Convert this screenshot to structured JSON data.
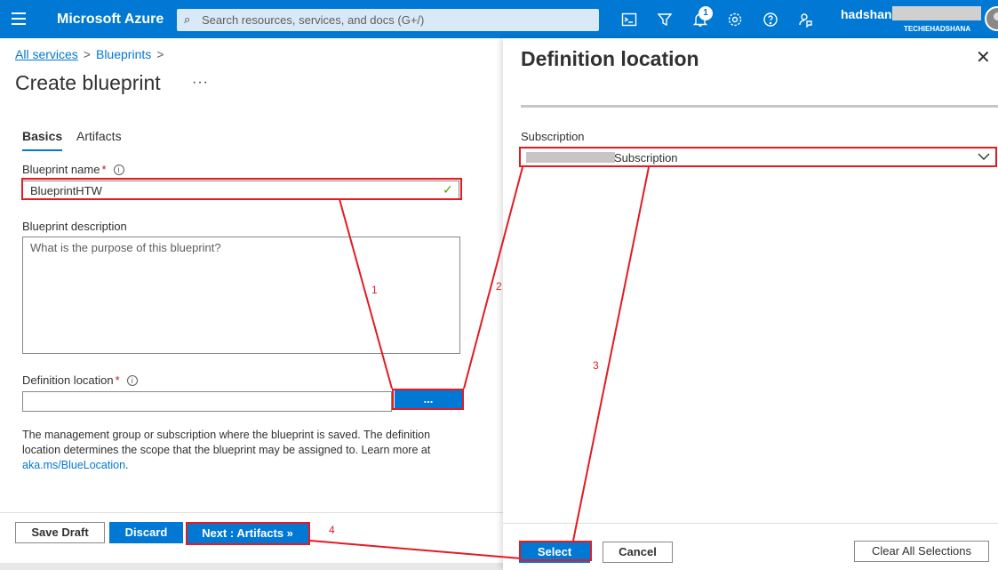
{
  "header": {
    "brand": "Microsoft Azure",
    "search_placeholder": "Search resources, services, and docs (G+/)",
    "notification_count": "1",
    "user_name": "hadshana",
    "user_directory": "TECHIEHADSHANA"
  },
  "breadcrumb": {
    "items": [
      "All services",
      "Blueprints"
    ]
  },
  "page": {
    "title": "Create blueprint",
    "more_label": "···"
  },
  "tabs": [
    "Basics",
    "Artifacts"
  ],
  "form": {
    "name_label": "Blueprint name",
    "name_value": "BlueprintHTW",
    "description_label": "Blueprint description",
    "description_placeholder": "What is the purpose of this blueprint?",
    "location_label": "Definition location",
    "location_button": "...",
    "help_text": "The management group or subscription where the blueprint is saved. The definition location determines the scope that the blueprint may be assigned to. Learn more at ",
    "help_link": "aka.ms/BlueLocation",
    "help_end": "."
  },
  "footer": {
    "save_draft": "Save Draft",
    "discard": "Discard",
    "next": "Next : Artifacts »"
  },
  "panel": {
    "title": "Definition location",
    "subscription_label": "Subscription",
    "subscription_value": "Subscription",
    "select": "Select",
    "cancel": "Cancel",
    "clear_all": "Clear All Selections"
  },
  "annotations": {
    "step1": "1",
    "step2": "2",
    "step3": "3",
    "step4": "4",
    "color": "#e31b23"
  },
  "colors": {
    "azure_blue": "#0078d4",
    "annotation_red": "#e31b23"
  }
}
